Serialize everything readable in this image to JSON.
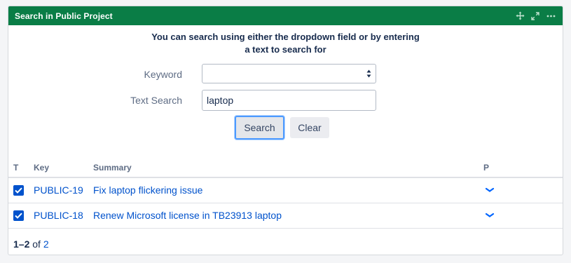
{
  "gadget": {
    "title": "Search in Public Project",
    "header_color": "#0a7d46",
    "icons": [
      "move-icon",
      "expand-icon",
      "more-icon"
    ]
  },
  "intro": {
    "line1": "You can search using either the dropdown field or by entering",
    "line2": "a text to search for"
  },
  "form": {
    "keyword_label": "Keyword",
    "keyword_value": "",
    "text_search_label": "Text Search",
    "text_search_value": "laptop",
    "search_button": "Search",
    "clear_button": "Clear"
  },
  "table": {
    "columns": {
      "type": "T",
      "key": "Key",
      "summary": "Summary",
      "priority": "P"
    },
    "rows": [
      {
        "key": "PUBLIC-19",
        "summary": "Fix laptop flickering issue",
        "type_icon": "task-checkbox-icon",
        "priority_icon": "priority-low-icon"
      },
      {
        "key": "PUBLIC-18",
        "summary": "Renew Microsoft license in TB23913 laptop",
        "type_icon": "task-checkbox-icon",
        "priority_icon": "priority-low-icon"
      }
    ]
  },
  "pagination": {
    "range": "1–2",
    "of": "of",
    "total": "2"
  },
  "colors": {
    "link": "#0052cc",
    "accent": "#0a7d46"
  }
}
